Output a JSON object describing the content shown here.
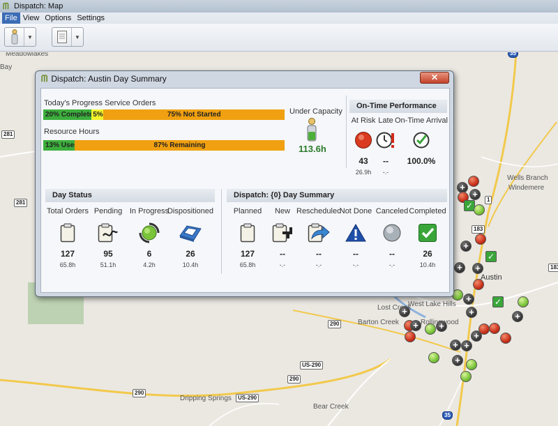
{
  "app": {
    "title": "Dispatch: Map"
  },
  "menu": [
    "File",
    "View",
    "Options",
    "Settings"
  ],
  "map": {
    "labels": [
      "Meadowlakes",
      "Bay",
      "Windemere",
      "Wells Branch",
      "Austin",
      "West Lake Hills",
      "Lost Creek",
      "Rollingwood",
      "Barton Creek",
      "Dripping Springs",
      "Bear Creek"
    ],
    "routes": [
      "35",
      "281",
      "281",
      "183",
      "183",
      "290",
      "290",
      "290",
      "US-290",
      "US-290",
      "35",
      "1"
    ]
  },
  "dialog": {
    "title": "Dispatch: Austin Day Summary",
    "close_label": "✕",
    "progress": {
      "label": "Today's Progress Service Orders",
      "complete": "20% Complete",
      "in_progress": "5%",
      "not_started": "75% Not Started",
      "complete_pct": 20,
      "in_progress_pct": 5,
      "not_started_pct": 75
    },
    "resources": {
      "label": "Resource Hours",
      "used": "13% Used",
      "remaining": "87% Remaining",
      "used_pct": 13,
      "remaining_pct": 87
    },
    "capacity": {
      "label": "Under Capacity",
      "value": "113.6h"
    },
    "on_time": {
      "header": "On-Time Performance",
      "at_risk": {
        "label": "At Risk",
        "count": "43",
        "hours": "26.9h"
      },
      "late": {
        "label": "Late",
        "count": "--",
        "hours": "-.-"
      },
      "arrival": {
        "label": "On-Time Arrival",
        "value": "100.0%"
      }
    },
    "day_status": {
      "header": "Day Status",
      "items": [
        {
          "label": "Total Orders",
          "count": "127",
          "hours": "65.8h",
          "icon": "clipboard-icon"
        },
        {
          "label": "Pending",
          "count": "95",
          "hours": "51.1h",
          "icon": "pending-icon"
        },
        {
          "label": "In Progress",
          "count": "6",
          "hours": "4.2h",
          "icon": "in-progress-icon"
        },
        {
          "label": "Dispositioned",
          "count": "26",
          "hours": "10.4h",
          "icon": "tray-icon"
        }
      ]
    },
    "summary": {
      "header": "Dispatch: {0} Day Summary",
      "items": [
        {
          "label": "Planned",
          "count": "127",
          "hours": "65.8h",
          "icon": "clipboard-icon"
        },
        {
          "label": "New",
          "count": "--",
          "hours": "-.-",
          "icon": "new-icon"
        },
        {
          "label": "Rescheduled",
          "count": "--",
          "hours": "-.-",
          "icon": "reschedule-icon"
        },
        {
          "label": "Not Done",
          "count": "--",
          "hours": "-.-",
          "icon": "warning-icon"
        },
        {
          "label": "Canceled",
          "count": "--",
          "hours": "-.-",
          "icon": "canceled-icon"
        },
        {
          "label": "Completed",
          "count": "26",
          "hours": "10.4h",
          "icon": "completed-icon"
        }
      ]
    }
  }
}
